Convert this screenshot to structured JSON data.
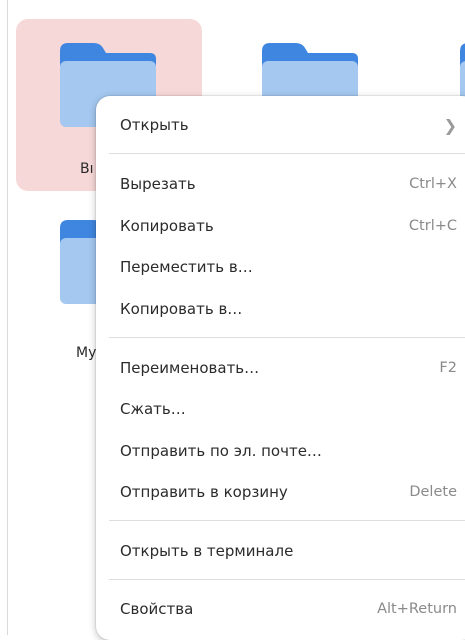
{
  "folders": [
    {
      "label": "Вı",
      "selected": true
    },
    {
      "label": "",
      "selected": false
    },
    {
      "label": "",
      "selected": false
    },
    {
      "label": "My",
      "selected": false
    }
  ],
  "context_menu": {
    "items": [
      {
        "label": "Открыть",
        "accel": "",
        "submenu": true,
        "icon": "chevron-right-icon"
      },
      {
        "label": "Вырезать",
        "accel": "Ctrl+X"
      },
      {
        "label": "Копировать",
        "accel": "Ctrl+C"
      },
      {
        "label": "Переместить в…",
        "accel": ""
      },
      {
        "label": "Копировать в…",
        "accel": ""
      },
      {
        "label": "Переименовать…",
        "accel": "F2"
      },
      {
        "label": "Сжать…",
        "accel": ""
      },
      {
        "label": "Отправить по эл. почте…",
        "accel": ""
      },
      {
        "label": "Отправить в корзину",
        "accel": "Delete"
      },
      {
        "label": "Открыть в терминале",
        "accel": ""
      },
      {
        "label": "Свойства",
        "accel": "Alt+Return"
      }
    ]
  },
  "colors": {
    "folder_back": "#3f86e0",
    "folder_front": "#a4c8f0",
    "selection": "#f7d8d8"
  }
}
